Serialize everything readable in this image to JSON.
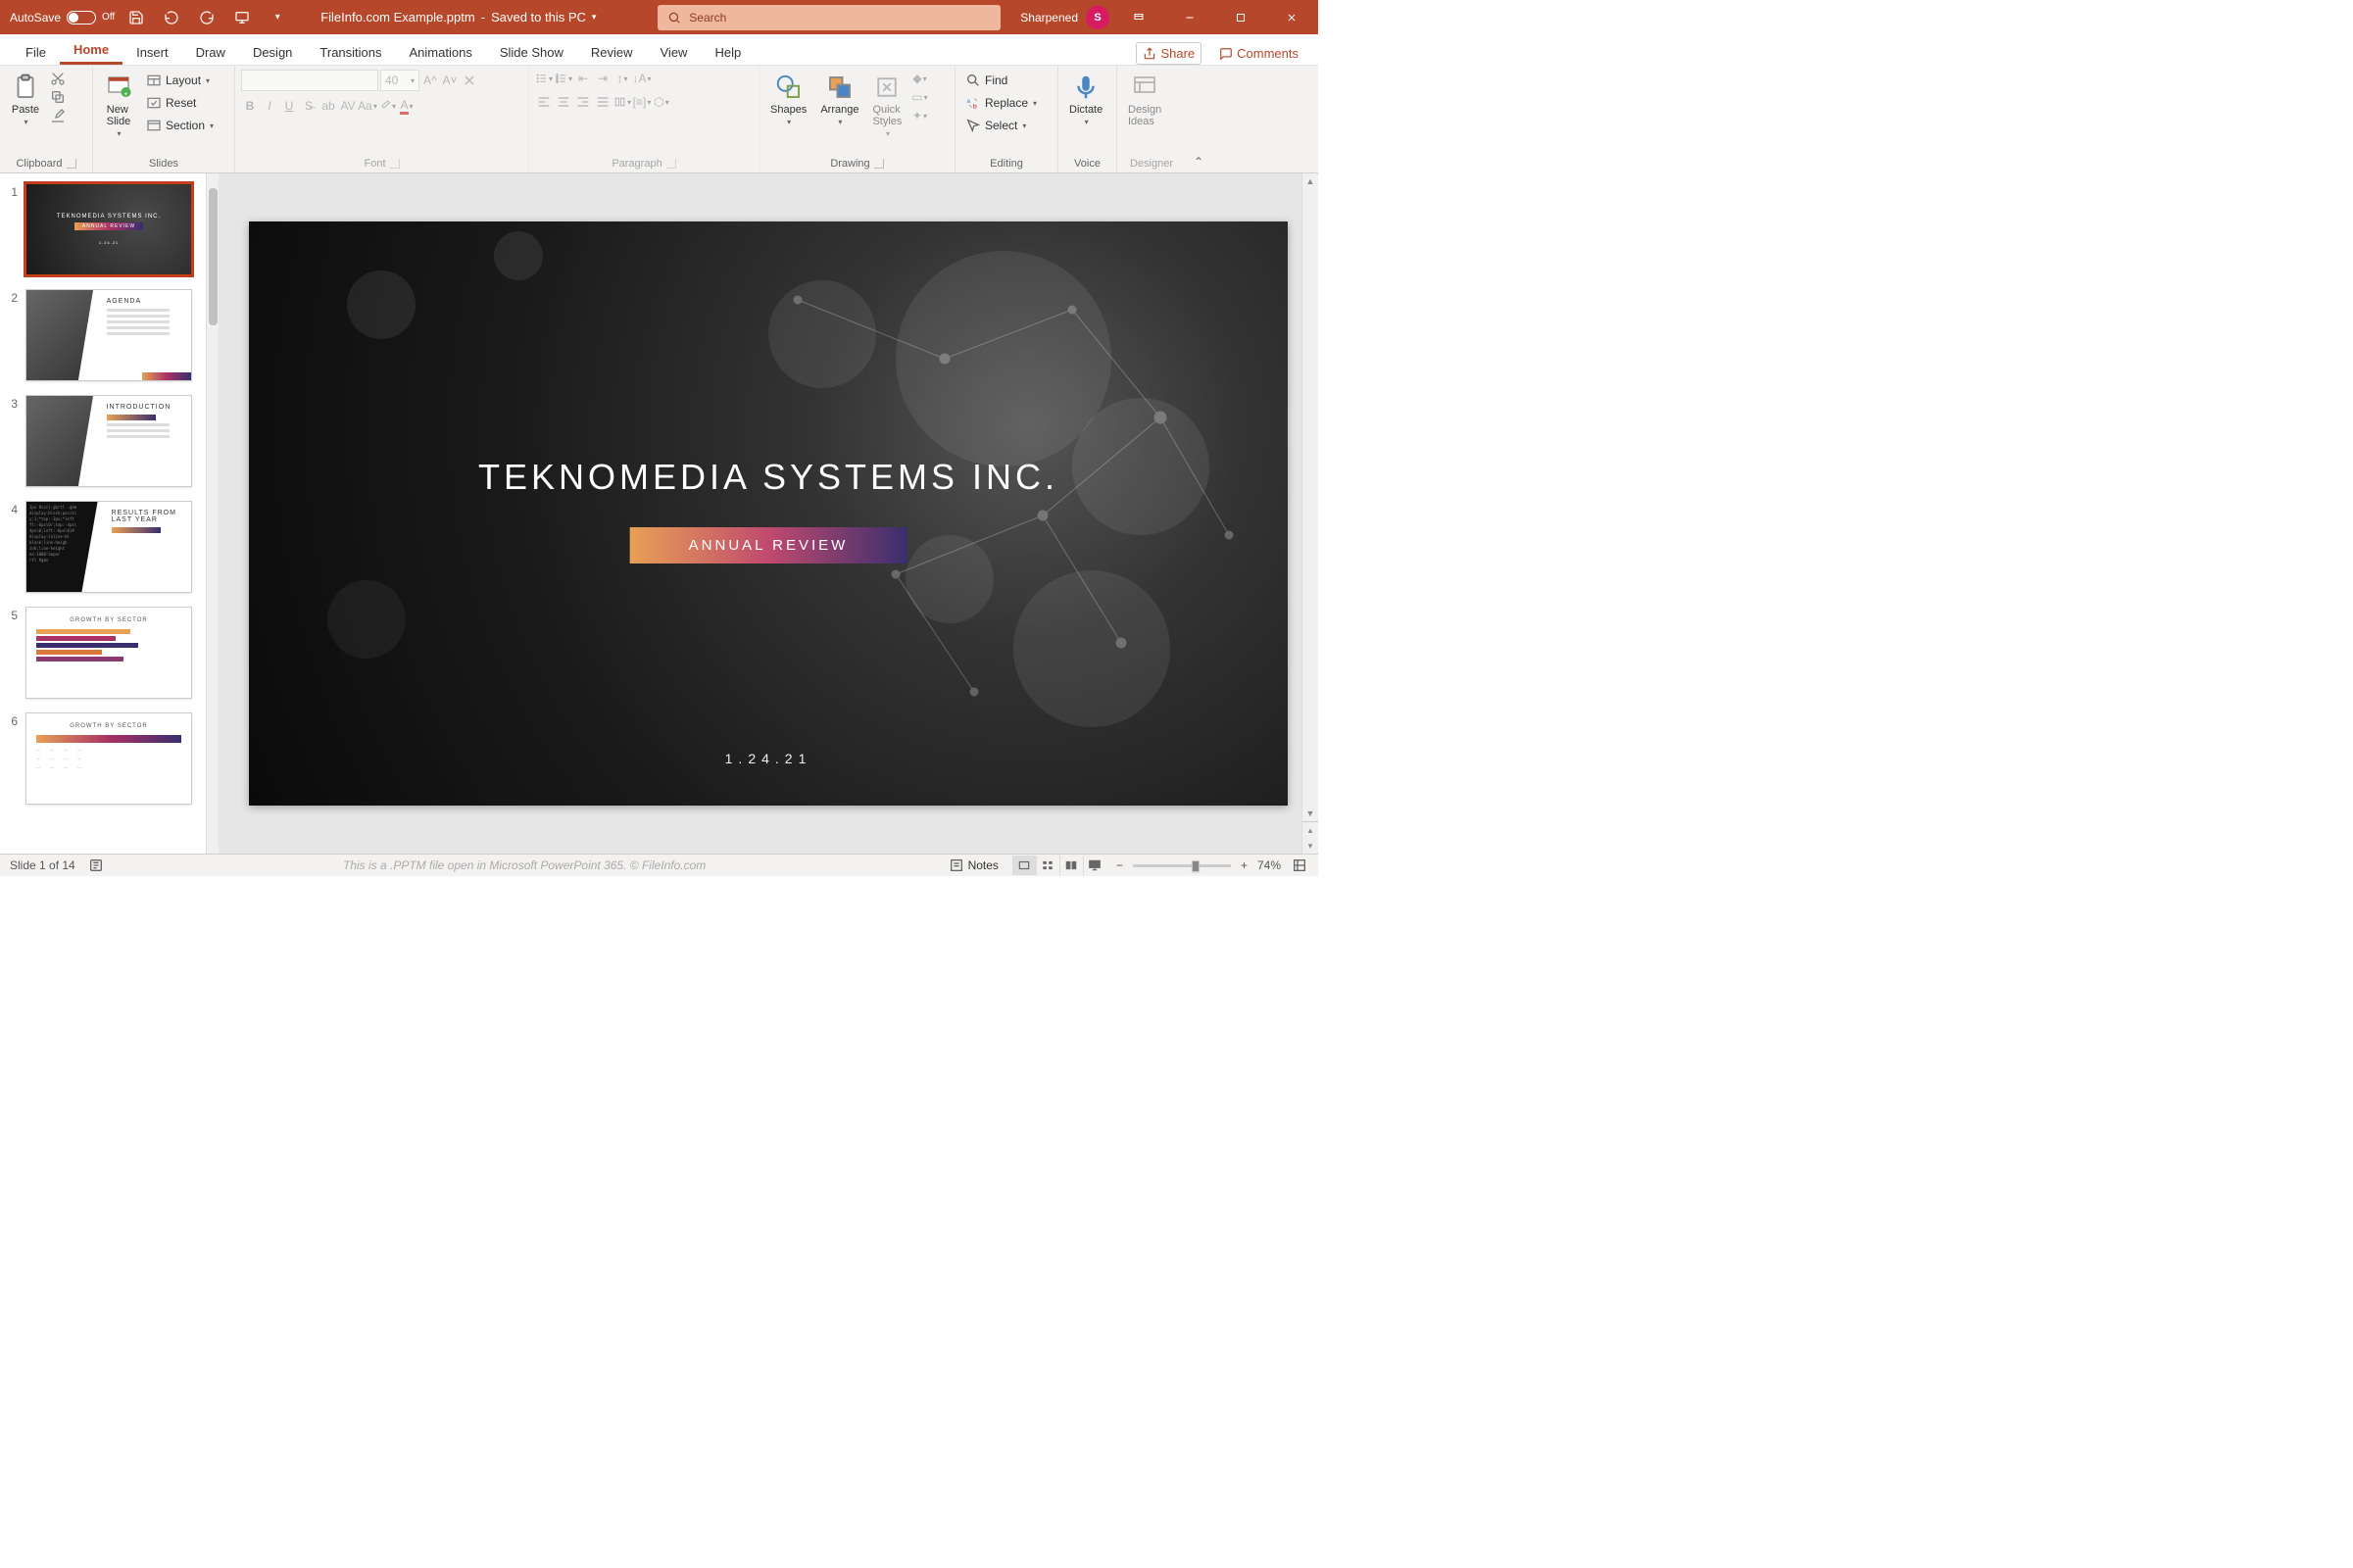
{
  "titlebar": {
    "autosave": "AutoSave",
    "autosave_state": "Off",
    "filename": "FileInfo.com Example.pptm",
    "save_status": "Saved to this PC",
    "search_placeholder": "Search",
    "username": "Sharpened",
    "avatar_initial": "S"
  },
  "tabs": [
    "File",
    "Home",
    "Insert",
    "Draw",
    "Design",
    "Transitions",
    "Animations",
    "Slide Show",
    "Review",
    "View",
    "Help"
  ],
  "active_tab": "Home",
  "ribbon_right": {
    "share": "Share",
    "comments": "Comments"
  },
  "ribbon": {
    "clipboard": {
      "paste": "Paste",
      "label": "Clipboard"
    },
    "slides": {
      "new_slide": "New\nSlide",
      "layout": "Layout",
      "reset": "Reset",
      "section": "Section",
      "label": "Slides"
    },
    "font": {
      "size": "40",
      "label": "Font"
    },
    "paragraph": {
      "label": "Paragraph"
    },
    "drawing": {
      "shapes": "Shapes",
      "arrange": "Arrange",
      "quick_styles": "Quick\nStyles",
      "label": "Drawing"
    },
    "editing": {
      "find": "Find",
      "replace": "Replace",
      "select": "Select",
      "label": "Editing"
    },
    "voice": {
      "dictate": "Dictate",
      "label": "Voice"
    },
    "designer": {
      "design_ideas": "Design\nIdeas",
      "label": "Designer"
    }
  },
  "thumbs": [
    {
      "n": "1",
      "type": "dark",
      "title": "TEKNOMEDIA SYSTEMS INC.",
      "banner": "ANNUAL REVIEW",
      "date": "1.24.21"
    },
    {
      "n": "2",
      "type": "light",
      "header": "AGENDA",
      "lines": [
        "INTRODUCTION",
        "RESULTS FROM LAST YEAR",
        "TEAM",
        "WHAT'S NEXT",
        "CLOSING"
      ]
    },
    {
      "n": "3",
      "type": "light",
      "header": "INTRODUCTION"
    },
    {
      "n": "4",
      "type": "code",
      "header": "RESULTS FROM\nLAST YEAR"
    },
    {
      "n": "5",
      "type": "chart",
      "header": "GROWTH BY SECTOR"
    },
    {
      "n": "6",
      "type": "table",
      "header": "GROWTH BY SECTOR"
    }
  ],
  "slide": {
    "title": "TEKNOMEDIA SYSTEMS INC.",
    "banner": "ANNUAL REVIEW",
    "date": "1.24.21"
  },
  "status": {
    "slide": "Slide 1 of 14",
    "footer": "This is a .PPTM file open in Microsoft PowerPoint 365. © FileInfo.com",
    "notes": "Notes",
    "zoom": "74%"
  }
}
